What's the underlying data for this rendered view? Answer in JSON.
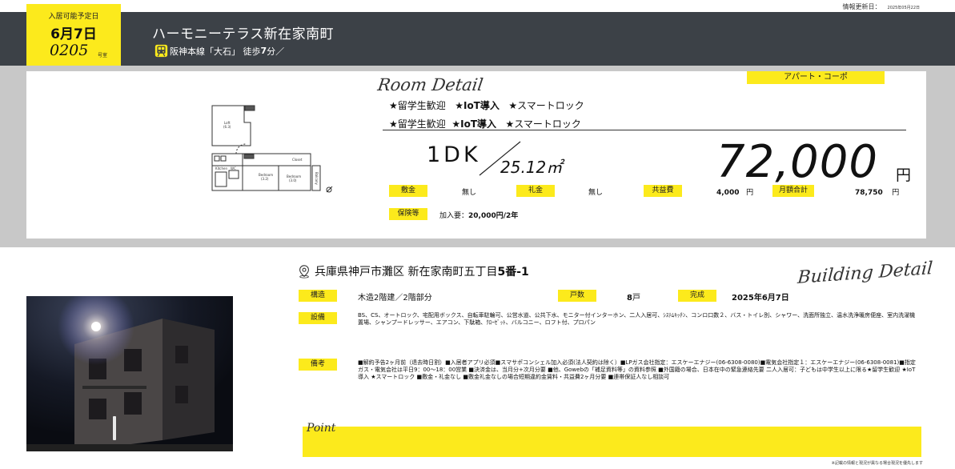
{
  "header": {
    "update_label": "情報更新日：",
    "update_date": "2025年05月22日",
    "title": "ハーモニーテラス新在家南町",
    "access_line": "阪神本線「大石」",
    "access_walk_label": "徒歩",
    "access_walk_minutes": "7",
    "access_walk_unit": "分／"
  },
  "ribbon": {
    "label": "入居可能予定日",
    "date_month": "6",
    "date_month_unit": "月",
    "date_day": "7",
    "date_day_unit": "日",
    "room_number": "0205",
    "room_suffix": "号室"
  },
  "room": {
    "section_title": "Room Detail",
    "building_type": "アパート・コーポ",
    "features_1": [
      "★留学生歓迎",
      "★IoT導入",
      "★スマートロック"
    ],
    "features_2": [
      "★留学生歓迎",
      "★IoT導入",
      "★スマートロック"
    ],
    "layout": "1DK",
    "area": "25.12㎡",
    "rent": "72,000",
    "rent_unit": "円",
    "deposit_label": "敷金",
    "deposit_value": "無し",
    "key_money_label": "礼金",
    "key_money_value": "無し",
    "common_fee_label": "共益費",
    "common_fee_value": "4,000",
    "common_fee_unit": "円",
    "monthly_total_label": "月額合計",
    "monthly_total_value": "78,750",
    "monthly_total_unit": "円",
    "insurance_label": "保険等",
    "insurance_prefix": "加入要：",
    "insurance_value": "20,000円/2年"
  },
  "floorplan_labels": {
    "loft": "Loft",
    "loft_size": "(6.3)",
    "kitchen": "Kitchen",
    "wc": "WC",
    "bedroom1": "Bedroom",
    "bedroom1_size": "(3.2)",
    "bedroom2": "Bedroom",
    "bedroom2_size": "(3.0)",
    "closet": "Closet",
    "balcony": "Balcony"
  },
  "building": {
    "section_title": "Building Detail",
    "address_prefix": "兵庫県神戸市灘区 新在家南町五丁目",
    "address_number": "5番-1",
    "structure_label": "構造",
    "structure_value": "木造2階建／2階部分",
    "units_label": "戸数",
    "units_value": "8",
    "units_unit": "戸",
    "completed_label": "完成",
    "completed_value": "2025年6月7日",
    "facilities_label": "設備",
    "facilities_text": "BS、CS、オートロック、宅配用ボックス、自転車駐輪可、公営水道、公共下水、モニター付インターホン、二人入居可、ｼｽﾃﾑｷｯﾁﾝ、コンロ口数２、バス・トイレ別、シャワー、洗面所独立、温水洗浄暖房便座、室内洗濯機置場、シャンプードレッサー、エアコン、下駄箱、ｸﾛｰｾﾞｯﾄ、バルコニー、ロフト付、プロパン",
    "remarks_label": "備考",
    "remarks_text": "■解約予告2ヶ月前（退去時日割）■入居者アプリ必須■スマサポコンシェル加入必須(法人契約は除く）■LPガス会社指定：エスケーエナジー(06-6308-0080)■電気会社指定１：エスケーエナジー(06-6308-0081)■指定ガス・電気会社は平日9：00～18：00営業 ■決済金は、当月分+次月分要 ■他、Gowebの「補足資料等」の資料参照 ■外国籍の場合、日本在中の緊急連絡先要 二人入居可：子どもは中学生以上に限る★留学生歓迎 ★IoT導入 ★スマートロック ■敷金・礼金なし ■敷金礼金なしの場合短期違約金賃料・共益費2ヶ月分要 ■連帯保証人なし相談可"
  },
  "point": {
    "label": "Point"
  },
  "footer": {
    "disclaimer": "※記載の情報と現況が異なる場合現況を優先します"
  },
  "colors": {
    "accent_yellow": "#fcea1c",
    "header_dark": "#3c4147",
    "band_gray": "#c8c8c8"
  }
}
